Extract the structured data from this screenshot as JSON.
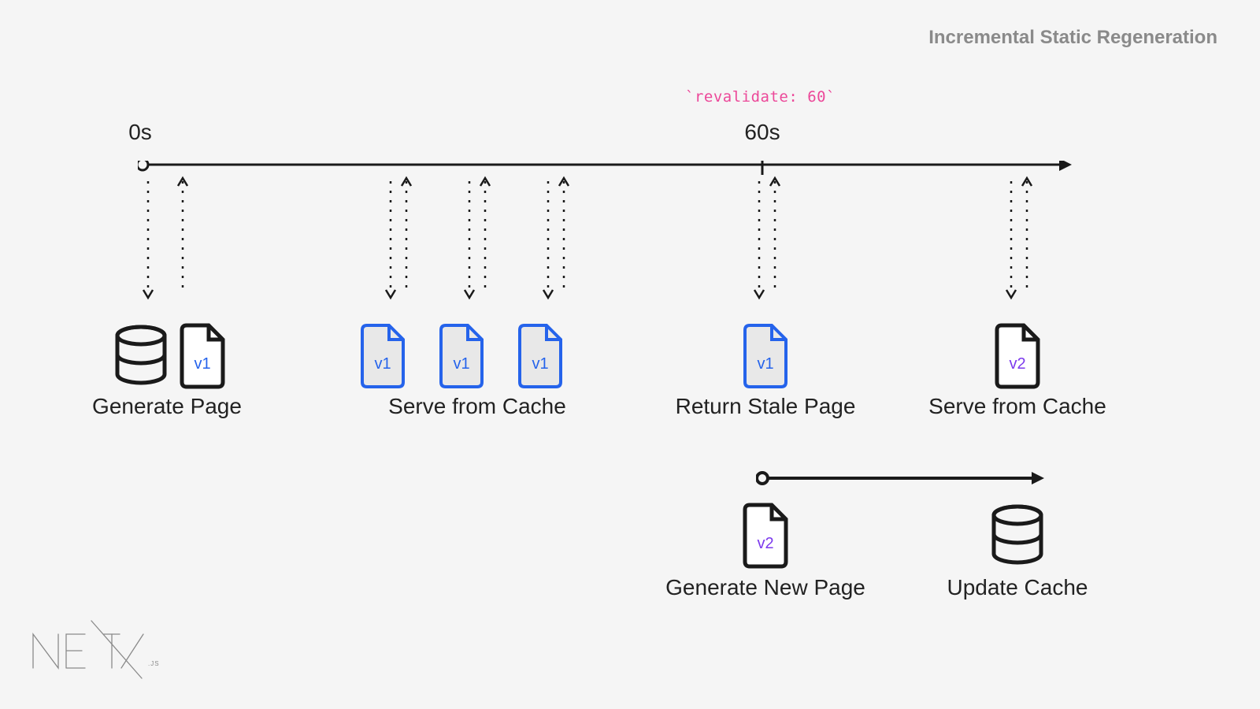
{
  "title": "Incremental Static Regeneration",
  "revalidate_code": "`revalidate: 60`",
  "timeline": {
    "start_label": "0s",
    "marker_label": "60s"
  },
  "steps": {
    "generate_page": {
      "label": "Generate Page",
      "version": "v1"
    },
    "serve_cache_1": {
      "label": "Serve from Cache",
      "versions": [
        "v1",
        "v1",
        "v1"
      ]
    },
    "return_stale": {
      "label": "Return Stale Page",
      "version": "v1"
    },
    "serve_cache_2": {
      "label": "Serve from Cache",
      "version": "v2"
    },
    "generate_new": {
      "label": "Generate New Page",
      "version": "v2"
    },
    "update_cache": {
      "label": "Update Cache"
    }
  },
  "logo_text": "NEXT",
  "logo_suffix": ".JS"
}
